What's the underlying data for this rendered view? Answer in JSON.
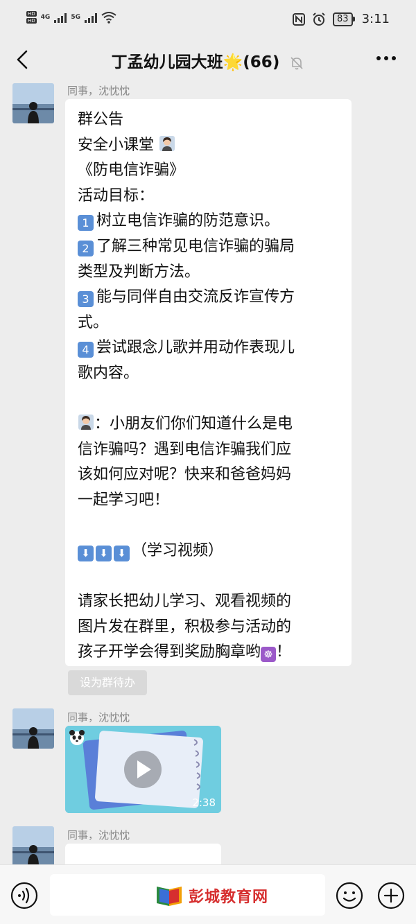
{
  "status_bar": {
    "network_1": "4G",
    "network_2": "5G",
    "hd": "HD",
    "battery": "83",
    "time": "3:11"
  },
  "header": {
    "title": "丁孟幼儿园大班",
    "sparkle": "🌟",
    "count": "(66)"
  },
  "messages": [
    {
      "sender": "同事，沈忱忱",
      "lines": {
        "l1": "群公告",
        "l2": "安全小课堂",
        "l3": "《防电信诈骗》",
        "l4": "活动目标：",
        "n1": "1",
        "l5": "树立电信诈骗的防范意识。",
        "n2": "2",
        "l6": "了解三种常见电信诈骗的骗局",
        "l7": "类型及判断方法。",
        "n3": "3",
        "l8": "能与同伴自由交流反诈宣传方",
        "l9": "式。",
        "n4": "4",
        "l10": "尝试跟念儿歌并用动作表现儿",
        "l11": "歌内容。",
        "l12": "：小朋友们你们知道什么是电",
        "l13": "信诈骗吗？遇到电信诈骗我们应",
        "l14": "该如何应对呢？快来和爸爸妈妈",
        "l15": "一起学习吧！",
        "arrow": "⬇",
        "l16": "（学习视频）",
        "l17": "请家长把幼儿学习、观看视频的",
        "l18": "图片发在群里，积极参与活动的",
        "l19": "孩子开学会得到奖励胸章哟",
        "wheel": "☸",
        "l19_end": "！"
      },
      "action": "设为群待办"
    },
    {
      "sender": "同事，沈忱忱",
      "video_duration": "2:38"
    },
    {
      "sender": "同事，沈忱忱"
    }
  ],
  "watermark": {
    "text": "彭城教育网"
  },
  "colors": {
    "background": "#ededed",
    "bubble": "#ffffff",
    "number_badge": "#5a8fd6",
    "watermark": "#d62f2f"
  },
  "icons": [
    "back-arrow-icon",
    "mute-bell-icon",
    "more-icon",
    "voice-icon",
    "emoji-icon",
    "plus-icon",
    "play-icon"
  ]
}
